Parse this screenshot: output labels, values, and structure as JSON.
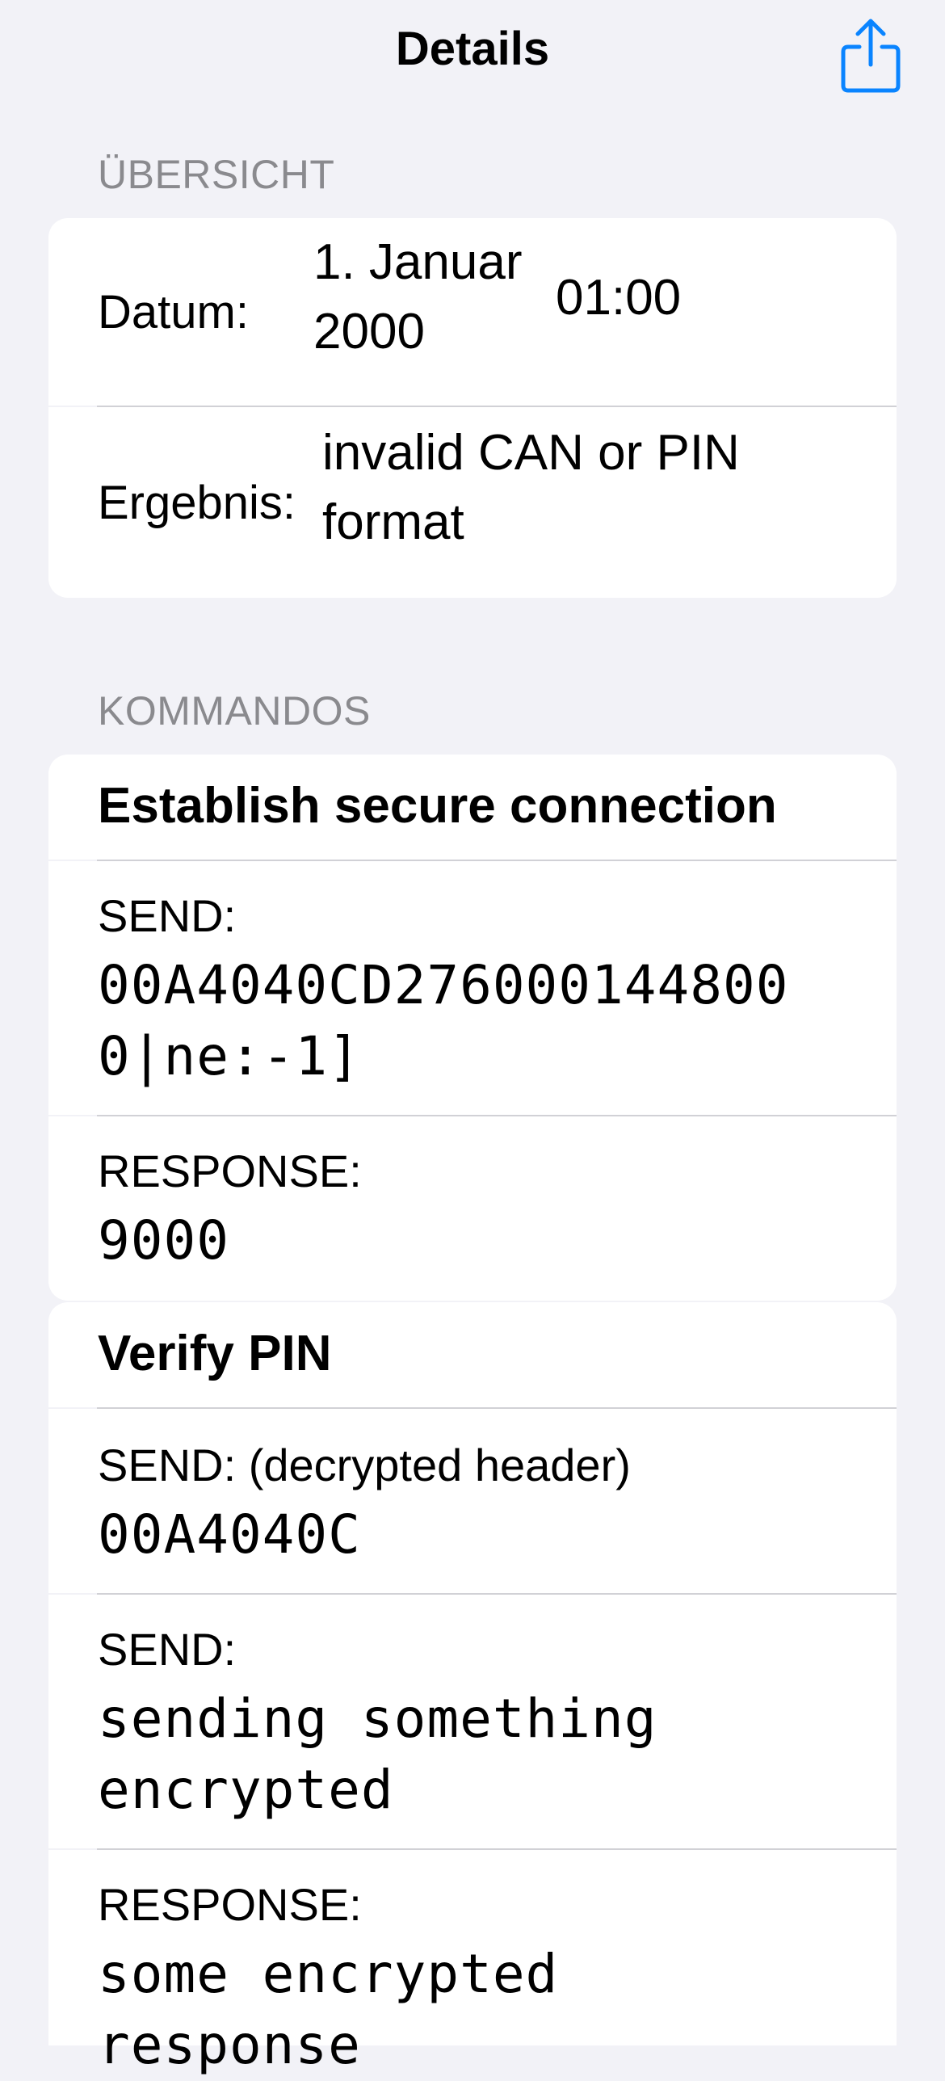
{
  "nav": {
    "title": "Details",
    "share_icon": "share-icon",
    "accent": "#0A84FF"
  },
  "overview": {
    "header": "ÜBERSICHT",
    "date_label": "Datum:",
    "date_line1": "1. Januar",
    "date_line2": "2000",
    "time": "01:00",
    "result_label": "Ergebnis:",
    "result_line1": "invalid CAN or PIN",
    "result_line2": "format"
  },
  "commands": {
    "header": "KOMMANDOS",
    "items": [
      {
        "title": "Establish secure connection",
        "entries": [
          {
            "label": "SEND:",
            "lines": [
              "00A4040CD276000144800",
              "0|ne:-1]"
            ]
          },
          {
            "label": "RESPONSE:",
            "lines": [
              "9000"
            ]
          }
        ]
      },
      {
        "title": "Verify PIN",
        "entries": [
          {
            "label": "SEND: (decrypted header)",
            "lines": [
              "00A4040C"
            ]
          },
          {
            "label": "SEND:",
            "lines": [
              "sending something",
              "encrypted"
            ]
          },
          {
            "label": "RESPONSE:",
            "lines": [
              "some encrypted",
              "response"
            ]
          }
        ]
      }
    ]
  },
  "colors": {
    "background": "#F2F2F7",
    "cell": "#FFFFFF",
    "secondary_text": "#8A8A8E",
    "separator": "#D1D1D6"
  }
}
